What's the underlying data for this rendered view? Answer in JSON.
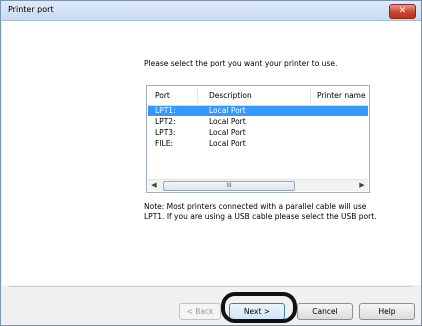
{
  "window": {
    "title": "Printer port",
    "close_label": "✕"
  },
  "instruction": "Please select the port you want your printer to use.",
  "port_list": {
    "columns": [
      "Port",
      "Description",
      "Printer name"
    ],
    "rows": [
      {
        "port": "LPT1:",
        "description": "Local Port",
        "selected": true
      },
      {
        "port": "LPT2:",
        "description": "Local Port",
        "selected": false
      },
      {
        "port": "LPT3:",
        "description": "Local Port",
        "selected": false
      },
      {
        "port": "FILE:",
        "description": "Local Port",
        "selected": false
      }
    ],
    "scroll_thumb_glyph": "III",
    "scroll_left_glyph": "◀",
    "scroll_right_glyph": "▶"
  },
  "note_line1": "Note: Most printers connected with a parallel cable will use",
  "note_line2": "LPT1. If you are using a USB cable please select the USB port.",
  "buttons": {
    "back": "< Back",
    "next": "Next >",
    "cancel": "Cancel",
    "help": "Help"
  },
  "colors": {
    "selection": "#3399ff",
    "highlight_ring": "#111111"
  }
}
